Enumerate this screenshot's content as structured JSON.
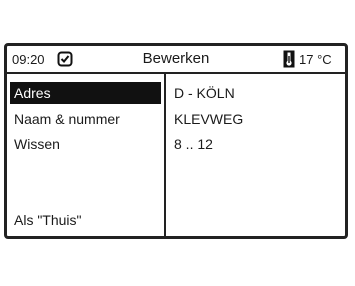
{
  "header": {
    "time": "09:20",
    "title": "Bewerken",
    "temperature": "17 °C",
    "icons": [
      "clock-check-icon",
      "thermometer-icon"
    ]
  },
  "menu": {
    "items": [
      {
        "label": "Adres",
        "selected": true
      },
      {
        "label": "Naam & nummer",
        "selected": false
      },
      {
        "label": "Wissen",
        "selected": false
      }
    ],
    "home_label": "Als \"Thuis\""
  },
  "details": {
    "city": "D - KÖLN",
    "street": "KLEVWEG",
    "number_range": "8 .. 12"
  },
  "colors": {
    "selection_bg": "#111111",
    "frame": "#222222"
  }
}
